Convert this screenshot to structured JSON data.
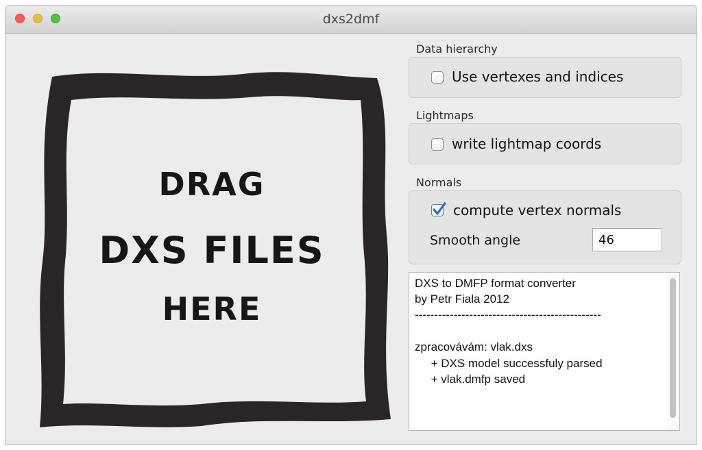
{
  "window": {
    "title": "dxs2dmf"
  },
  "dropzone": {
    "line1": "DRAG",
    "line2": "DXS FILES",
    "line3": "HERE"
  },
  "data_hierarchy": {
    "label": "Data hierarchy",
    "use_vertexes": {
      "label": "Use vertexes and indices",
      "checked": false
    }
  },
  "lightmaps": {
    "label": "Lightmaps",
    "write_coords": {
      "label": "write lightmap coords",
      "checked": false
    }
  },
  "normals": {
    "label": "Normals",
    "compute_normals": {
      "label": "compute vertex normals",
      "checked": true
    },
    "smooth_angle": {
      "label": "Smooth angle",
      "value": "46"
    }
  },
  "log": {
    "lines": [
      "DXS to DMFP format converter",
      "by Petr Fiala 2012",
      "------------------------------------------------",
      "",
      "zpracovávám: vlak.dxs",
      "     + DXS model successfuly parsed",
      "     + vlak.dmfp saved"
    ]
  },
  "colors": {
    "checkbox_accent": "#2a6fd0",
    "frame_ink": "#2a2627"
  }
}
